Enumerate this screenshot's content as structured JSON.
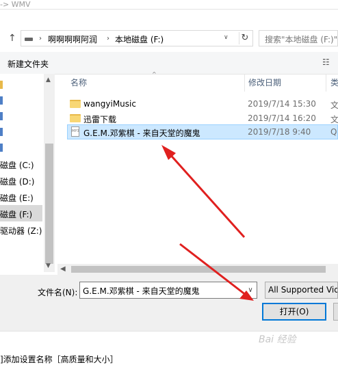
{
  "top_hint": "-> WMV",
  "address": {
    "crumbs": [
      "啊啊啊啊阿润",
      "本地磁盘 (F:)"
    ],
    "search_placeholder": "搜索\"本地磁盘 (F:)\""
  },
  "toolbar": {
    "new_folder": "新建文件夹"
  },
  "nav": {
    "partial_items": [
      "",
      "",
      "",
      "",
      ""
    ],
    "drives": [
      "磁盘 (C:)",
      "磁盘 (D:)",
      "磁盘 (E:)",
      "磁盘 (F:)",
      "驱动器 (Z:)"
    ],
    "selected": "磁盘 (F:)"
  },
  "columns": {
    "name": "名称",
    "modified": "修改日期",
    "type": "类"
  },
  "files": [
    {
      "name": "wangyiMusic",
      "modified": "2019/7/14 15:30",
      "type": "文",
      "kind": "folder-icon"
    },
    {
      "name": "迅雷下载",
      "modified": "2019/7/14 16:20",
      "type": "文",
      "kind": "folder-icon"
    },
    {
      "name": "G.E.M.邓紫棋 - 来自天堂的魔鬼",
      "modified": "2019/7/18 9:40",
      "type": "Q",
      "kind": "mp3-file-icon",
      "selected": true
    }
  ],
  "bottom": {
    "filename_label": "文件名(N):",
    "filename_value": "G.E.M.邓紫棋 - 来自天堂的魔鬼",
    "filter_value": "All Supported Vid",
    "open_label": "打开(O)"
  },
  "page_bottom_text": "]添加设置名称［高质量和大小］",
  "watermark": "Bai 经验",
  "colors": {
    "selection": "#cce8ff",
    "accent": "#0078d7",
    "arrow": "#e0201f"
  }
}
